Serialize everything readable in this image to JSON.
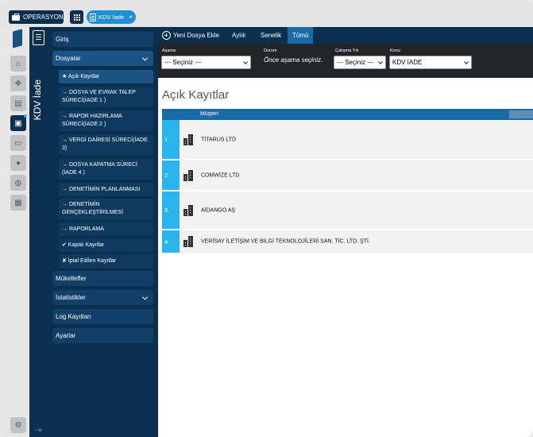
{
  "topbar": {
    "operations_label": "OPERASYON",
    "operations_icon": "briefcase-icon",
    "apps_icon": "grid-icon",
    "open_tab_label": "KDV İade",
    "open_tab_close": "×"
  },
  "rail": {
    "items": [
      "home-icon",
      "move-icon",
      "book-icon",
      "briefcase-icon",
      "card-icon",
      "user-icon",
      "globe-icon",
      "calculator-icon",
      "user-settings-icon"
    ],
    "active_item": "briefcase-icon"
  },
  "section": {
    "title": "KDV İade"
  },
  "nav": {
    "items": [
      {
        "label": "Giriş"
      },
      {
        "label": "Dosyalar"
      },
      {
        "label": "Mükellefler"
      },
      {
        "label": "İstatistikler"
      },
      {
        "label": "Log Kayıtları"
      },
      {
        "label": "Ayarlar"
      }
    ],
    "sub_items": [
      {
        "label": "★ Açık Kayıtlar"
      },
      {
        "label": "→ DOSYA VE EVRAK TALEP SÜRECİ(İADE 1 )"
      },
      {
        "label": "→ RAPOR HAZIRLAMA SÜRECİ(İADE 2 )"
      },
      {
        "label": "→ VERGİ DAİRESİ SÜRECİ(İADE 3)"
      },
      {
        "label": "→ DOSYA KAPATMA SÜRECİ (İADE 4 )"
      },
      {
        "label": "→ DENETİMİN PLANLANMASI"
      },
      {
        "label": "→ DENETİMİN GERÇEKLEŞTİRİLMESİ"
      },
      {
        "label": "→ RAPORLAMA"
      },
      {
        "label": "✔ Kapalı Kayıtlar"
      },
      {
        "label": "✘ İptal Edilen Kayıtlar"
      }
    ]
  },
  "toolbar": {
    "add_label": "Yeni Dosya Ekle",
    "tabs": [
      {
        "label": "Aylık"
      },
      {
        "label": "Senelik"
      },
      {
        "label": "Tümü"
      }
    ],
    "active_tab": "Tümü"
  },
  "filters": {
    "asama_label": "Aşama",
    "asama_value": "--- Seçiniz ---",
    "durum_label": "Durum",
    "durum_note": "Önce aşama seçiniz.",
    "yil_label": "Çalışma Yılı",
    "yil_value": "--- Seçiniz ---",
    "konu_label": "Konu",
    "konu_value": "KDV İADE"
  },
  "main": {
    "title": "Açık Kayıtlar",
    "column_header": "Müşteri",
    "rows": [
      {
        "num": "1.",
        "name": "TİTARUS LTD"
      },
      {
        "num": "2.",
        "name": "COMWİZE LTD"
      },
      {
        "num": "3.",
        "name": "AİDANGO AŞ"
      },
      {
        "num": "4.",
        "name": "VERİSAY İLETİŞİM VE BİLGİ TEKNOLOJİLERİ SAN. TİC. LTD. ŞTİ."
      }
    ]
  },
  "colors": {
    "navy": "#0b2f4f",
    "accent": "#1a6aa6",
    "row_number": "#2ab4ee"
  }
}
